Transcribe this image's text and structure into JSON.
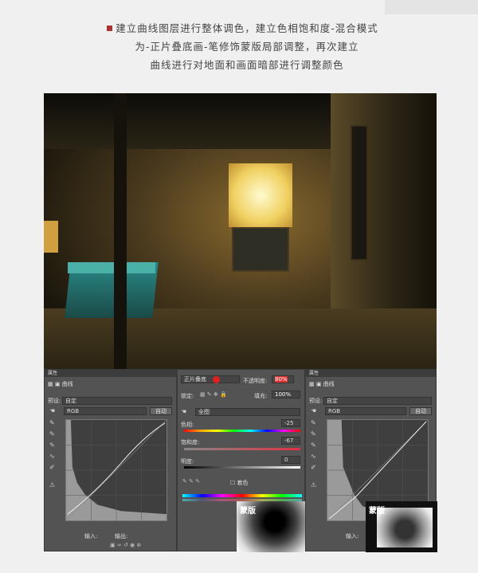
{
  "intro": {
    "lines": [
      "建立曲线图层进行整体调色，建立色相饱和度-混合模式",
      "为-正片叠底画-笔修饰蒙版局部调整，再次建立",
      "曲线进行对地面和画面暗部进行调整颜色"
    ],
    "bullet_color": "#aa3333"
  },
  "curves_left": {
    "title": "属性",
    "layer_type": "曲线",
    "preset_label": "预设:",
    "preset_value": "自定",
    "channel": "RGB",
    "auto_label": "自动",
    "input_label": "输入:",
    "output_label": "输出:"
  },
  "hue_sat": {
    "blend_mode": "正片叠底",
    "opacity_label": "不透明度:",
    "opacity_value": "80%",
    "lock_label": "锁定:",
    "fill_label": "填充:",
    "fill_value": "100%",
    "range": "全图",
    "hue_label": "色相:",
    "hue_value": "-25",
    "sat_label": "饱和度:",
    "sat_value": "-67",
    "light_label": "明度:",
    "light_value": "0",
    "colorize_label": "着色",
    "mask_label": "蒙版"
  },
  "curves_right": {
    "title": "属性",
    "layer_type": "曲线",
    "preset_label": "预设:",
    "preset_value": "自定",
    "channel": "RGB",
    "auto_label": "自动",
    "input_label": "输入:",
    "mask_label": "蒙版"
  }
}
